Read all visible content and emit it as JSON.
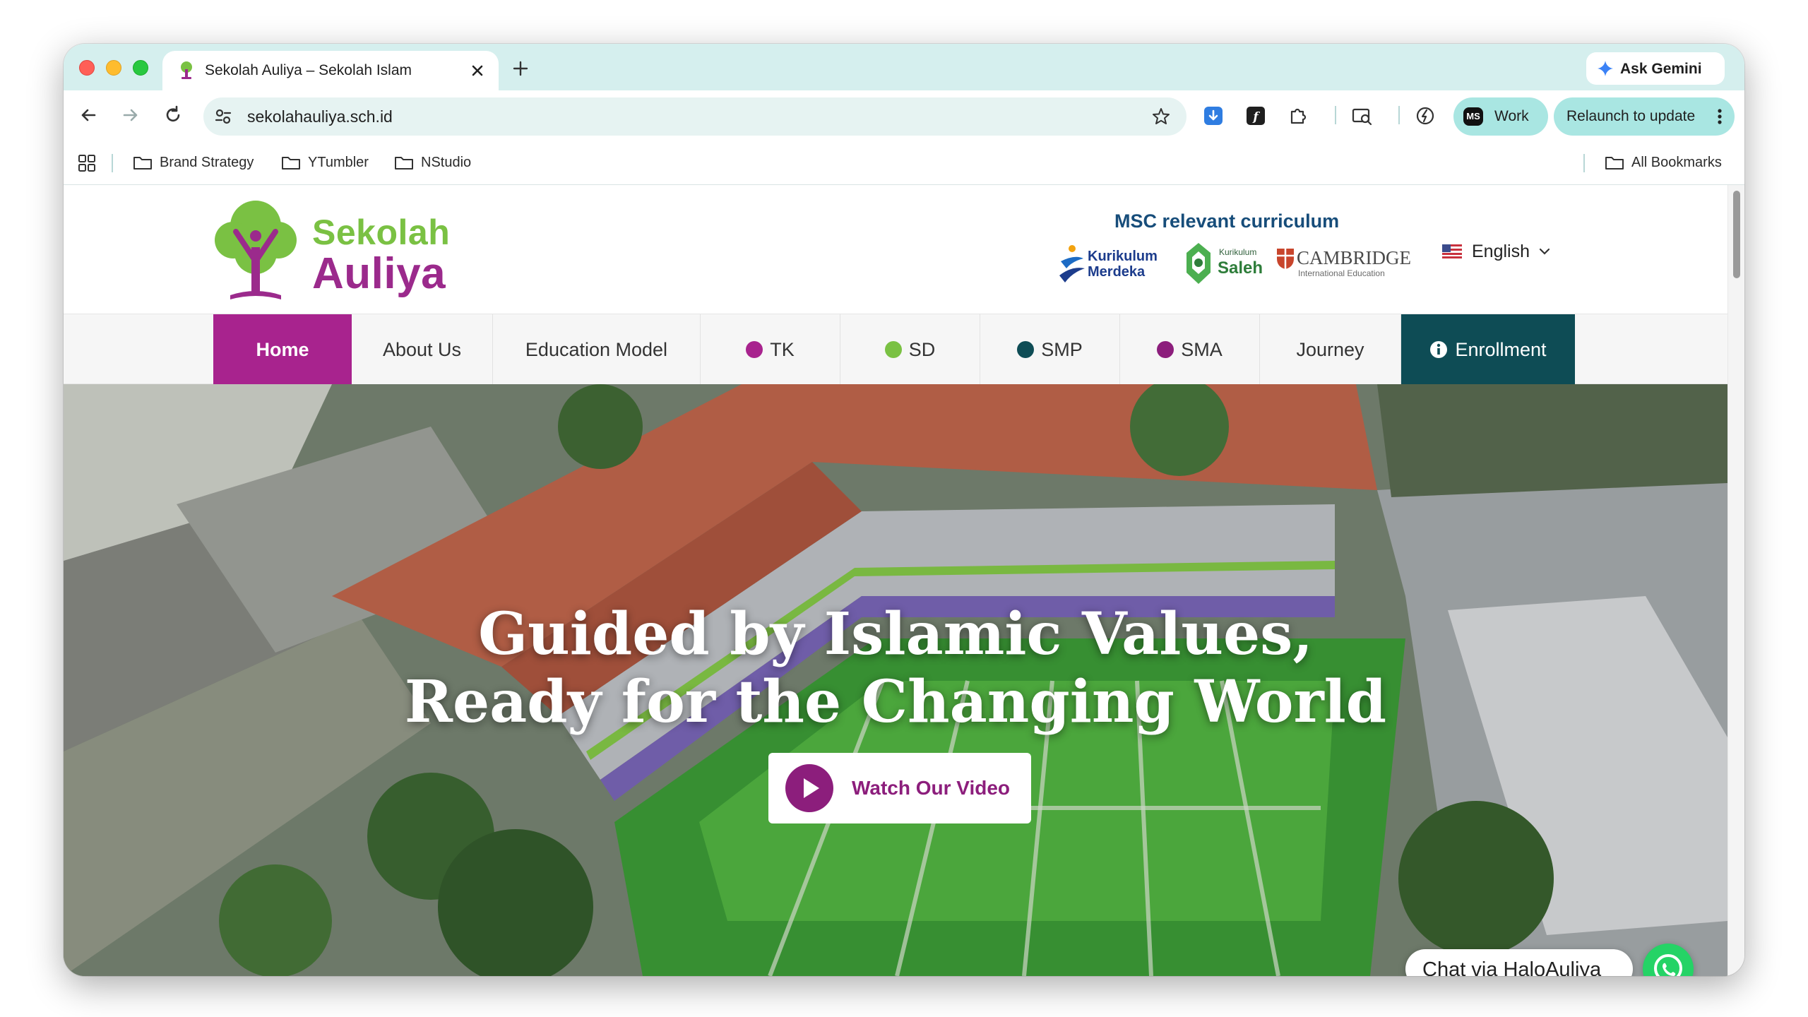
{
  "browser": {
    "tab_title": "Sekolah Auliya – Sekolah Islam",
    "gemini_label": "Ask Gemini",
    "url": "sekolahauliya.sch.id",
    "profile_label": "Work",
    "profile_avatar": "MS",
    "relaunch_label": "Relaunch to update",
    "bookmarks": [
      "Brand Strategy",
      "YTumbler",
      "NStudio"
    ],
    "all_bookmarks_label": "All Bookmarks"
  },
  "site": {
    "logo_line1": "Sekolah",
    "logo_line2": "Auliya",
    "curriculum_heading": "MSC relevant curriculum",
    "curriculum": {
      "km_line1": "Kurikulum",
      "km_line2": "Merdeka",
      "ks_line1": "Kurikulum",
      "ks_line2": "Saleh",
      "cam_line1": "CAMBRIDGE",
      "cam_line2": "International Education"
    },
    "language": "English"
  },
  "nav": {
    "items": [
      {
        "label": "Home"
      },
      {
        "label": "About Us"
      },
      {
        "label": "Education Model"
      },
      {
        "label": "TK",
        "dot_color": "#a8238e"
      },
      {
        "label": "SD",
        "dot_color": "#7ac143"
      },
      {
        "label": "SMP",
        "dot_color": "#0e4c55"
      },
      {
        "label": "SMA",
        "dot_color": "#8c1e7c"
      },
      {
        "label": "Journey"
      },
      {
        "label": "Enrollment"
      }
    ]
  },
  "hero": {
    "title_line1": "Guided by Islamic Values,",
    "title_line2": "Ready for the Changing World",
    "watch_label": "Watch Our Video"
  },
  "chat": {
    "label": "Chat via HaloAuliya"
  },
  "colors": {
    "brand_purple": "#a8238e",
    "brand_green": "#7ac143",
    "brand_teal": "#0e4c55"
  }
}
